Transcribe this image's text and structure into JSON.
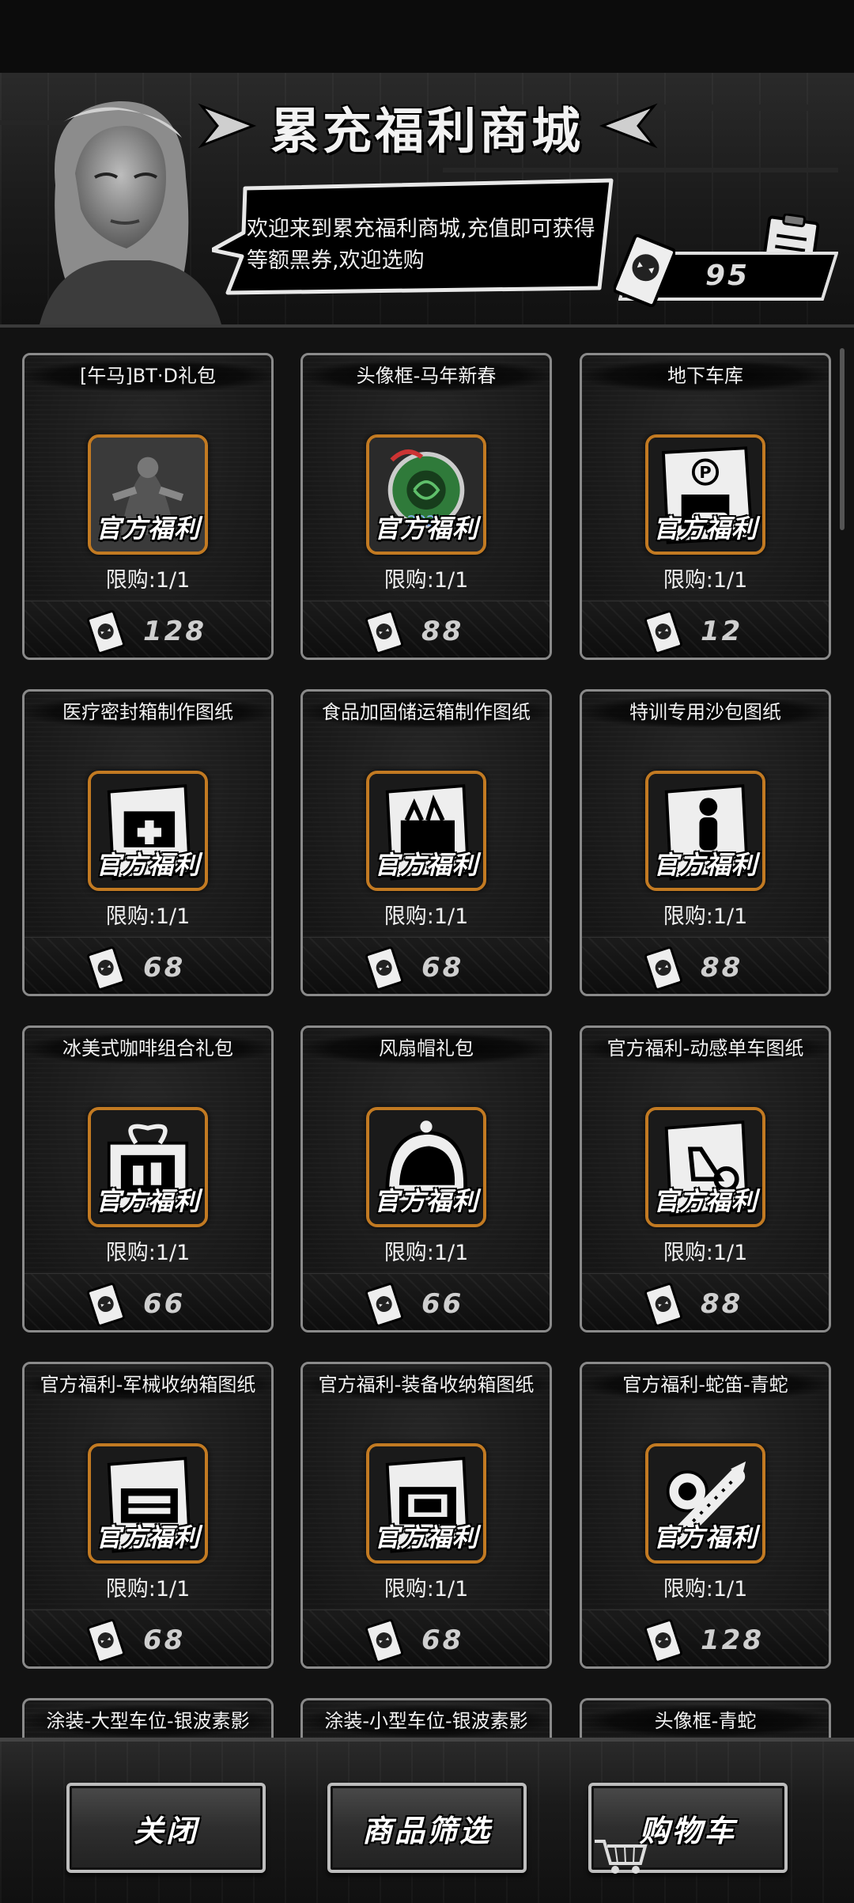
{
  "header": {
    "title": "累充福利商城",
    "welcome_text": "欢迎来到累充福利商城,充值即可获得等额黑券,欢迎选购",
    "record_label": "记录",
    "balance": "95"
  },
  "card_common": {
    "official_badge": "官方福利"
  },
  "items": [
    {
      "title": "[午马]BT·D礼包",
      "limit": "限购:1/1",
      "price": "128",
      "icon": "mecha-figure-icon"
    },
    {
      "title": "头像框-马年新春",
      "limit": "限购:1/1",
      "price": "88",
      "icon": "avatar-frame-2026-icon"
    },
    {
      "title": "地下车库",
      "limit": "限购:1/1",
      "price": "12",
      "icon": "parking-garage-icon"
    },
    {
      "title": "医疗密封箱制作图纸",
      "limit": "限购:1/1",
      "price": "68",
      "icon": "blueprint-medical-box-icon"
    },
    {
      "title": "食品加固储运箱制作图纸",
      "limit": "限购:1/1",
      "price": "68",
      "icon": "blueprint-food-box-icon"
    },
    {
      "title": "特训专用沙包图纸",
      "limit": "限购:1/1",
      "price": "88",
      "icon": "blueprint-sandbag-icon"
    },
    {
      "title": "冰美式咖啡组合礼包",
      "limit": "限购:1/1",
      "price": "66",
      "icon": "gift-box-icon"
    },
    {
      "title": "风扇帽礼包",
      "limit": "限购:1/1",
      "price": "66",
      "icon": "fan-hat-icon"
    },
    {
      "title": "官方福利-动感单车图纸",
      "limit": "限购:1/1",
      "price": "88",
      "icon": "blueprint-bike-icon"
    },
    {
      "title": "官方福利-军械收纳箱图纸",
      "limit": "限购:1/1",
      "price": "68",
      "icon": "blueprint-weapon-box-icon"
    },
    {
      "title": "官方福利-装备收纳箱图纸",
      "limit": "限购:1/1",
      "price": "68",
      "icon": "blueprint-gear-box-icon"
    },
    {
      "title": "官方福利-蛇笛-青蛇",
      "limit": "限购:1/1",
      "price": "128",
      "icon": "snake-flute-icon"
    },
    {
      "title": "涂装-大型车位-银波素影",
      "limit": "",
      "price": "",
      "icon": ""
    },
    {
      "title": "涂装-小型车位-银波素影",
      "limit": "",
      "price": "",
      "icon": ""
    },
    {
      "title": "头像框-青蛇",
      "limit": "",
      "price": "",
      "icon": ""
    }
  ],
  "footer": {
    "close_label": "关闭",
    "filter_label": "商品筛选",
    "cart_label": "购物车"
  },
  "colors": {
    "frame_orange": "#c27a22",
    "card_border": "#8a8a8a",
    "background": "#121212"
  }
}
